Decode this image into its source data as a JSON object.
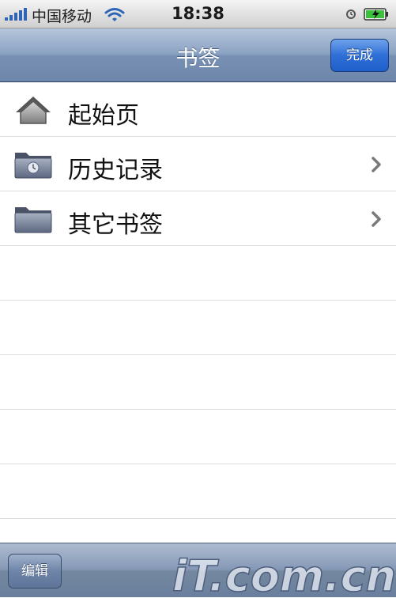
{
  "status_bar": {
    "carrier": "中国移动",
    "time": "18:38"
  },
  "nav_bar": {
    "title": "书签",
    "done_label": "完成"
  },
  "list": {
    "items": [
      {
        "label": "起始页",
        "icon": "home-icon",
        "has_chevron": false
      },
      {
        "label": "历史记录",
        "icon": "history-folder-icon",
        "has_chevron": true
      },
      {
        "label": "其它书签",
        "icon": "folder-icon",
        "has_chevron": true
      }
    ]
  },
  "toolbar": {
    "edit_label": "编辑",
    "watermark": "iT.com.cn"
  },
  "colors": {
    "nav_bar": "#8aa2c2",
    "done_button": "#2f6fd6",
    "signal": "#2e65b7",
    "battery": "#3cc13c"
  }
}
